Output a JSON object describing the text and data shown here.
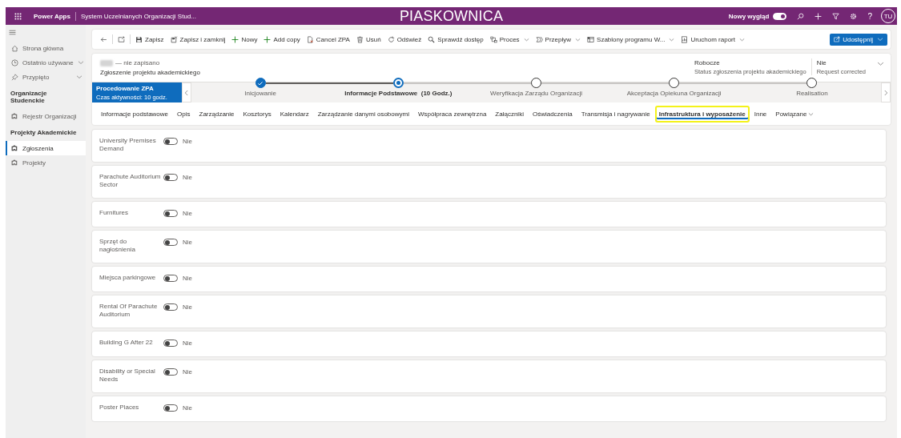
{
  "header": {
    "app": "Power Apps",
    "title": "System Uczelnianych Organizacji Stud...",
    "environment": "PIASKOWNICA",
    "new_look": {
      "label": "Nowy wygląd",
      "on": true
    },
    "help": "?",
    "avatar": "TU"
  },
  "sidebar": {
    "items": [
      {
        "kind": "item",
        "label": "Strona główna",
        "selected": false
      },
      {
        "kind": "menu",
        "label": "Ostatnio używane",
        "selected": false
      },
      {
        "kind": "menu",
        "label": "Przypięto",
        "selected": false
      },
      {
        "kind": "section",
        "label": "Organizacje Studenckie"
      },
      {
        "kind": "item",
        "label": "Rejestr Organizacji",
        "selected": false
      },
      {
        "kind": "section",
        "label": "Projekty Akademickie"
      },
      {
        "kind": "item",
        "label": "Zgłoszenia",
        "selected": true
      },
      {
        "kind": "item",
        "label": "Projekty",
        "selected": false
      }
    ]
  },
  "toolbar": {
    "commands": [
      {
        "label": "Zapisz",
        "has_menu": false
      },
      {
        "label": "Zapisz i zamknij",
        "has_menu": false
      },
      {
        "label": "Nowy",
        "has_menu": false
      },
      {
        "label": "Add copy",
        "has_menu": false
      },
      {
        "label": "Cancel ZPA",
        "has_menu": false
      },
      {
        "label": "Usuń",
        "has_menu": false
      },
      {
        "label": "Odśwież",
        "has_menu": false
      },
      {
        "label": "Sprawdź dostęp",
        "has_menu": false
      },
      {
        "label": "Proces",
        "has_menu": true
      },
      {
        "label": "Przepływ",
        "has_menu": true
      },
      {
        "label": "Szablony programu W...",
        "has_menu": true
      },
      {
        "label": "Uruchom raport",
        "has_menu": true
      }
    ],
    "share": "Udostępnij"
  },
  "record": {
    "status_note": "— nie zapisano",
    "entity": "Zgłoszenie projektu akademickiego",
    "fields": [
      {
        "value": "Robocze",
        "label": "Status zgłoszenia projektu akademickiego"
      },
      {
        "value": "Nie",
        "label": "Request corrected"
      }
    ]
  },
  "process": {
    "name": "Procedowanie ZPA",
    "duration": "Czas aktywności: 10 godz.",
    "stages": [
      {
        "label": "Inicjowanie",
        "completed": true,
        "selected": false
      },
      {
        "label": "Informacje Podstawowe  (10 Godz.)",
        "completed": false,
        "selected": true
      },
      {
        "label": "Weryfikacja Zarządu Organizacji",
        "completed": false,
        "selected": false
      },
      {
        "label": "Akceptacja Opiekuna Organizacji",
        "completed": false,
        "selected": false
      },
      {
        "label": "Realisation",
        "completed": false,
        "selected": false
      }
    ]
  },
  "tabs": [
    {
      "label": "Informacje podstawowe",
      "selected": false,
      "has_menu": false
    },
    {
      "label": "Opis",
      "selected": false,
      "has_menu": false
    },
    {
      "label": "Zarządzanie",
      "selected": false,
      "has_menu": false
    },
    {
      "label": "Kosztorys",
      "selected": false,
      "has_menu": false
    },
    {
      "label": "Kalendarz",
      "selected": false,
      "has_menu": false
    },
    {
      "label": "Zarządzanie danymi osobowymi",
      "selected": false,
      "has_menu": false
    },
    {
      "label": "Współpraca zewnętrzna",
      "selected": false,
      "has_menu": false
    },
    {
      "label": "Załączniki",
      "selected": false,
      "has_menu": false
    },
    {
      "label": "Oświadczenia",
      "selected": false,
      "has_menu": false
    },
    {
      "label": "Transmisja i nagrywanie",
      "selected": false,
      "has_menu": false
    },
    {
      "label": "Infrastruktura i wyposażenie",
      "selected": true,
      "has_menu": false
    },
    {
      "label": "Inne",
      "selected": false,
      "has_menu": false
    },
    {
      "label": "Powiązane",
      "selected": false,
      "has_menu": true
    }
  ],
  "fields": [
    {
      "label": "University Premises Demand",
      "on": false,
      "value": "Nie"
    },
    {
      "label": "Parachute Auditorium Sector",
      "on": false,
      "value": "Nie"
    },
    {
      "label": "Furnitures",
      "on": false,
      "value": "Nie"
    },
    {
      "label": "Sprzęt do nagłośnienia",
      "on": false,
      "value": "Nie"
    },
    {
      "label": "Miejsca parkingowe",
      "on": false,
      "value": "Nie"
    },
    {
      "label": "Rental Of Parachute Auditorium",
      "on": false,
      "value": "Nie"
    },
    {
      "label": "Building G After 22",
      "on": false,
      "value": "Nie"
    },
    {
      "label": "Disability or Special Needs",
      "on": false,
      "value": "Nie"
    },
    {
      "label": "Poster Places",
      "on": false,
      "value": "Nie"
    }
  ]
}
